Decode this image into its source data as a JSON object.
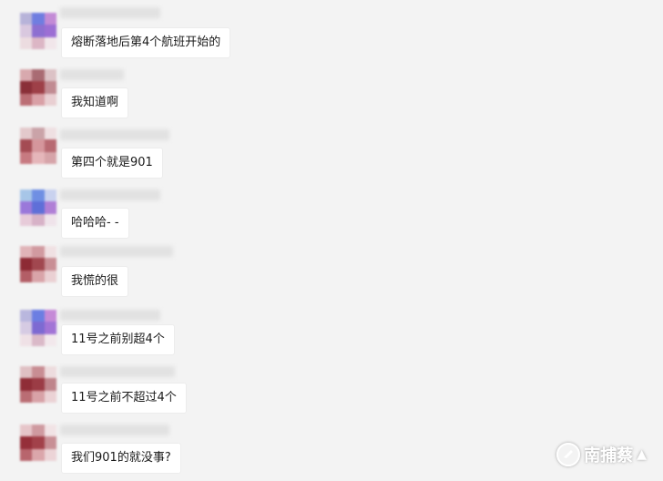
{
  "messages": [
    {
      "avatar": "mixed-blue-purple",
      "text": "熔断落地后第4个航班开始的"
    },
    {
      "avatar": "dark-red",
      "text": "我知道啊"
    },
    {
      "avatar": "dark-red",
      "text": "第四个就是901"
    },
    {
      "avatar": "mixed-blue-purple",
      "text": "哈哈哈- -"
    },
    {
      "avatar": "dark-red",
      "text": "我慌的很"
    },
    {
      "avatar": "mixed-blue-purple",
      "text": "11号之前别超4个"
    },
    {
      "avatar": "dark-red",
      "text": "11号之前不超过4个"
    },
    {
      "avatar": "dark-red",
      "text": "我们901的就没事?"
    }
  ],
  "watermark": {
    "text": "南捕蔡"
  },
  "colors": {
    "background": "#f3f3f3",
    "bubble": "#ffffff",
    "text": "#1a1a1a"
  }
}
